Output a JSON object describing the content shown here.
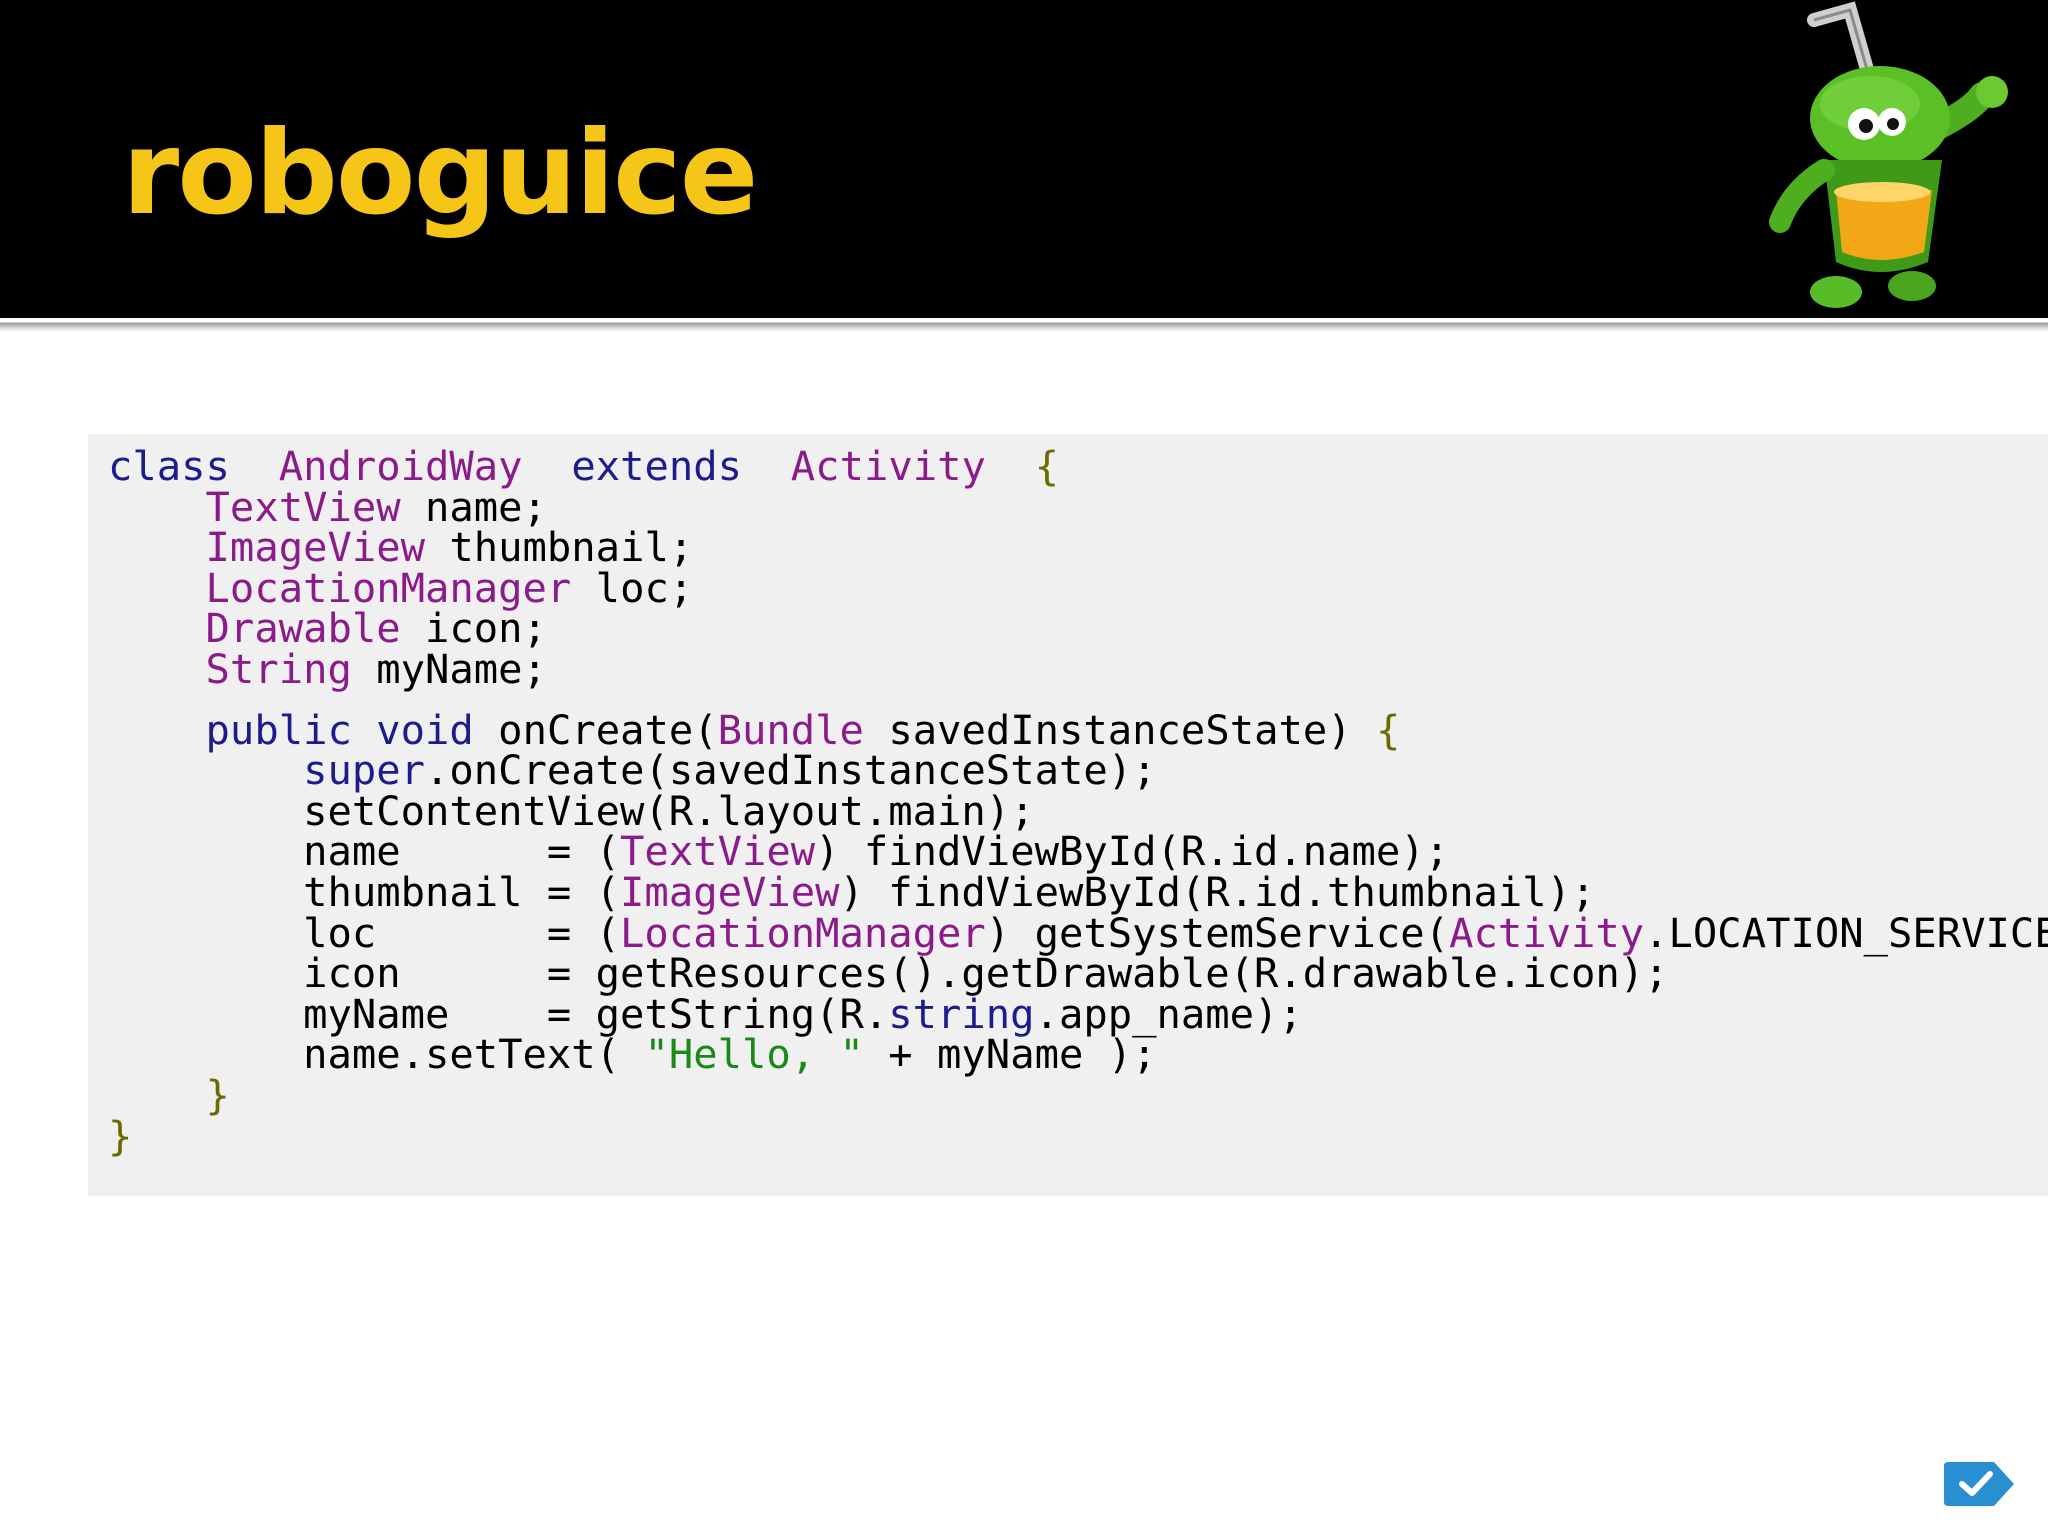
{
  "slide": {
    "title": "roboguice"
  },
  "colors": {
    "header_bg": "#000000",
    "title": "#f5c518",
    "code_bg": "#f0f0f0",
    "keyword": "#1c1c8c",
    "type": "#8b1a8b",
    "string": "#178a17",
    "badge": "#2a8fd1"
  },
  "icons": {
    "mascot": "roboguice-android-mascot",
    "badge": "checkmark-icon"
  },
  "code": {
    "lines": [
      [
        [
          "kw",
          "class"
        ],
        [
          "",
          "  "
        ],
        [
          "ty",
          "AndroidWay"
        ],
        [
          "",
          "  "
        ],
        [
          "kw",
          "extends"
        ],
        [
          "",
          "  "
        ],
        [
          "ty",
          "Activity"
        ],
        [
          "",
          "  "
        ],
        [
          "pu",
          "{"
        ]
      ],
      [
        [
          "",
          "    "
        ],
        [
          "ty",
          "TextView"
        ],
        [
          "",
          " name;"
        ]
      ],
      [
        [
          "",
          "    "
        ],
        [
          "ty",
          "ImageView"
        ],
        [
          "",
          " thumbnail;"
        ]
      ],
      [
        [
          "",
          "    "
        ],
        [
          "ty",
          "LocationManager"
        ],
        [
          "",
          " loc;"
        ]
      ],
      [
        [
          "",
          "    "
        ],
        [
          "ty",
          "Drawable"
        ],
        [
          "",
          " icon;"
        ]
      ],
      [
        [
          "",
          "    "
        ],
        [
          "ty",
          "String"
        ],
        [
          "",
          " myName;"
        ]
      ],
      [],
      [
        [
          "",
          "    "
        ],
        [
          "kw",
          "public"
        ],
        [
          "",
          " "
        ],
        [
          "kw",
          "void"
        ],
        [
          "",
          " onCreate("
        ],
        [
          "ty",
          "Bundle"
        ],
        [
          "",
          " savedInstanceState) "
        ],
        [
          "pu",
          "{"
        ]
      ],
      [
        [
          "",
          "        "
        ],
        [
          "kw",
          "super"
        ],
        [
          "",
          ".onCreate(savedInstanceState);"
        ]
      ],
      [
        [
          "",
          "        setContentView(R.layout.main);"
        ]
      ],
      [
        [
          "",
          "        name      = ("
        ],
        [
          "ty",
          "TextView"
        ],
        [
          "",
          ") findViewById(R.id.name);"
        ]
      ],
      [
        [
          "",
          "        thumbnail = ("
        ],
        [
          "ty",
          "ImageView"
        ],
        [
          "",
          ") findViewById(R.id.thumbnail);"
        ]
      ],
      [
        [
          "",
          "        loc       = ("
        ],
        [
          "ty",
          "LocationManager"
        ],
        [
          "",
          ") getSystemService("
        ],
        [
          "ty",
          "Activity"
        ],
        [
          "",
          ".LOCATION_SERVICE"
        ]
      ],
      [
        [
          "",
          "        icon      = getResources().getDrawable(R.drawable.icon);"
        ]
      ],
      [
        [
          "",
          "        myName    = getString(R."
        ],
        [
          "kw",
          "string"
        ],
        [
          "",
          ".app_name);"
        ]
      ],
      [
        [
          "",
          "        name.setText( "
        ],
        [
          "st",
          "\"Hello, \""
        ],
        [
          "",
          " + myName );"
        ]
      ],
      [
        [
          "",
          "    "
        ],
        [
          "pu",
          "}"
        ]
      ],
      [
        [
          "pu",
          "}"
        ]
      ]
    ]
  }
}
